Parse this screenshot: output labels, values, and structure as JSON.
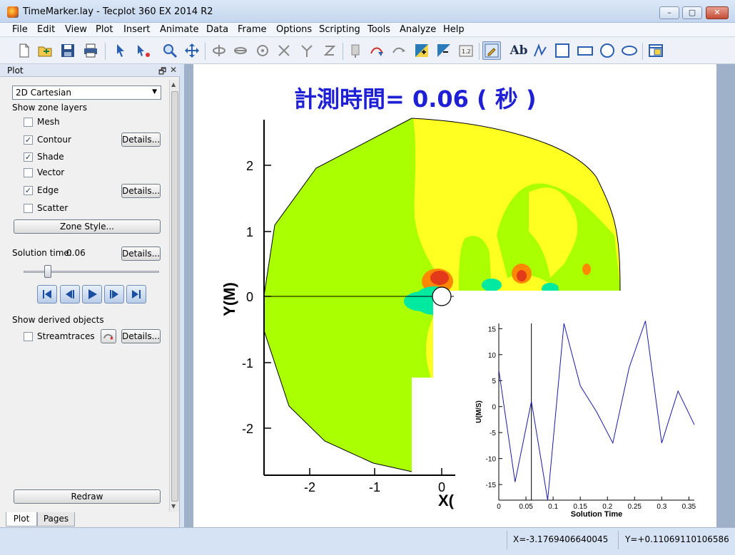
{
  "window": {
    "title": "TimeMarker.lay - Tecplot 360 EX 2014 R2",
    "minimize": "–",
    "maximize": "▢",
    "close": "✕"
  },
  "menu": [
    "File",
    "Edit",
    "View",
    "Plot",
    "Insert",
    "Animate",
    "Data",
    "Frame",
    "Options",
    "Scripting",
    "Tools",
    "Analyze",
    "Help"
  ],
  "toolbar": {
    "icons": [
      "new-file-icon",
      "open-file-icon",
      "save-icon",
      "print-icon",
      "select-arrow-icon",
      "adjustor-icon",
      "zoom-icon",
      "translate-icon",
      "rotate-x-icon",
      "rotate-y-icon",
      "spherical-rotate-icon",
      "rotate-xz-icon",
      "rotate-yz-icon",
      "rotate-z-icon",
      "probe-icon",
      "slice-icon",
      "streamtrace-icon",
      "add-zone-icon",
      "subtract-zone-icon",
      "label-icon",
      "quick-edit-icon",
      "text-icon",
      "polyline-icon",
      "square-icon",
      "rectangle-icon",
      "circle-icon",
      "ellipse-icon",
      "frame-icon"
    ],
    "text_label": "Ab"
  },
  "panel": {
    "title": "Plot",
    "plot_type": "2D Cartesian",
    "show_zone_layers": "Show zone layers",
    "layers": [
      {
        "label": "Mesh",
        "checked": false
      },
      {
        "label": "Contour",
        "checked": true,
        "details": "Details..."
      },
      {
        "label": "Shade",
        "checked": true
      },
      {
        "label": "Vector",
        "checked": false
      },
      {
        "label": "Edge",
        "checked": true,
        "details": "Details..."
      },
      {
        "label": "Scatter",
        "checked": false
      }
    ],
    "zone_style": "Zone Style...",
    "solution_time_label": "Solution time:",
    "solution_time_value": "0.06",
    "solution_time_details": "Details...",
    "slider_position": 0.17,
    "show_derived_objects": "Show derived objects",
    "streamtraces": {
      "label": "Streamtraces",
      "checked": false,
      "details": "Details..."
    },
    "redraw": "Redraw",
    "tabs": [
      "Plot",
      "Pages"
    ],
    "active_tab": "Plot"
  },
  "plot": {
    "title": "計測時間= 0.06 ( 秒 )",
    "title_color": "#1f1fd6",
    "ylabel": "Y(M)",
    "xlabel_partial": "X(",
    "x_ticks": [
      "-2",
      "-1",
      "0"
    ],
    "y_ticks": [
      "2",
      "1",
      "0",
      "-1",
      "-2"
    ],
    "contour_colors": [
      "#aaff00",
      "#ffff22",
      "#ff8800",
      "#e23a1a",
      "#00e9a0",
      "#33c0ff"
    ]
  },
  "chart_data": {
    "type": "line",
    "xlabel": "Solution Time",
    "ylabel": "U(M/S)",
    "xlim": [
      0,
      0.36
    ],
    "ylim": [
      -18,
      16
    ],
    "x_ticks": [
      "0",
      "0.05",
      "0.1",
      "0.15",
      "0.2",
      "0.25",
      "0.3",
      "0.35"
    ],
    "y_ticks": [
      "15",
      "10",
      "5",
      "0",
      "-5",
      "-10",
      "-15"
    ],
    "time_marker": 0.06,
    "line_color": "#1a1aa8",
    "x": [
      0,
      0.03,
      0.06,
      0.09,
      0.12,
      0.15,
      0.18,
      0.21,
      0.24,
      0.27,
      0.3,
      0.33,
      0.36
    ],
    "y": [
      7,
      -14.5,
      1,
      -18,
      16,
      4,
      -1,
      -7,
      7.5,
      16.5,
      -7,
      3,
      -3.5
    ]
  },
  "status": {
    "x_coord": "X=-3.1769406640045",
    "y_coord": "Y=+0.11069110106586"
  }
}
